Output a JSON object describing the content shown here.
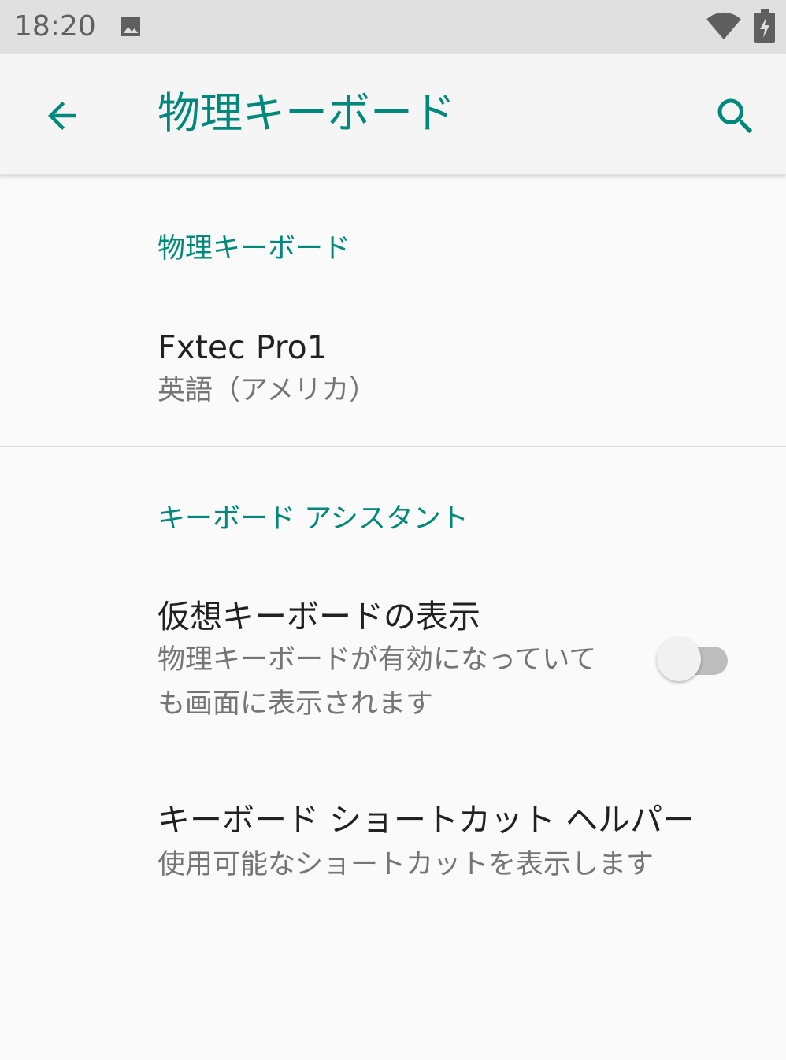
{
  "status_bar": {
    "time": "18:20",
    "icons": [
      "image-icon",
      "wifi-icon",
      "battery-charging-icon"
    ]
  },
  "toolbar": {
    "back_icon": "arrow-back-icon",
    "title": "物理キーボード",
    "search_icon": "search-icon"
  },
  "sections": [
    {
      "header": "物理キーボード",
      "items": [
        {
          "title": "Fxtec Pro1",
          "summary": "英語（アメリカ）"
        }
      ]
    },
    {
      "header": "キーボード アシスタント",
      "items": [
        {
          "title": "仮想キーボードの表示",
          "summary": "物理キーボードが有効になっていても画面に表示されます",
          "switch_checked": false
        },
        {
          "title": "キーボード ショートカット ヘルパー",
          "summary": "使用可能なショートカットを表示します"
        }
      ]
    }
  ],
  "colors": {
    "accent": "#00897b",
    "primary_text": "#212121",
    "secondary_text": "#757575",
    "status_bar": "#e0e0e0",
    "toolbar": "#f5f5f5",
    "background": "#fafafa"
  }
}
